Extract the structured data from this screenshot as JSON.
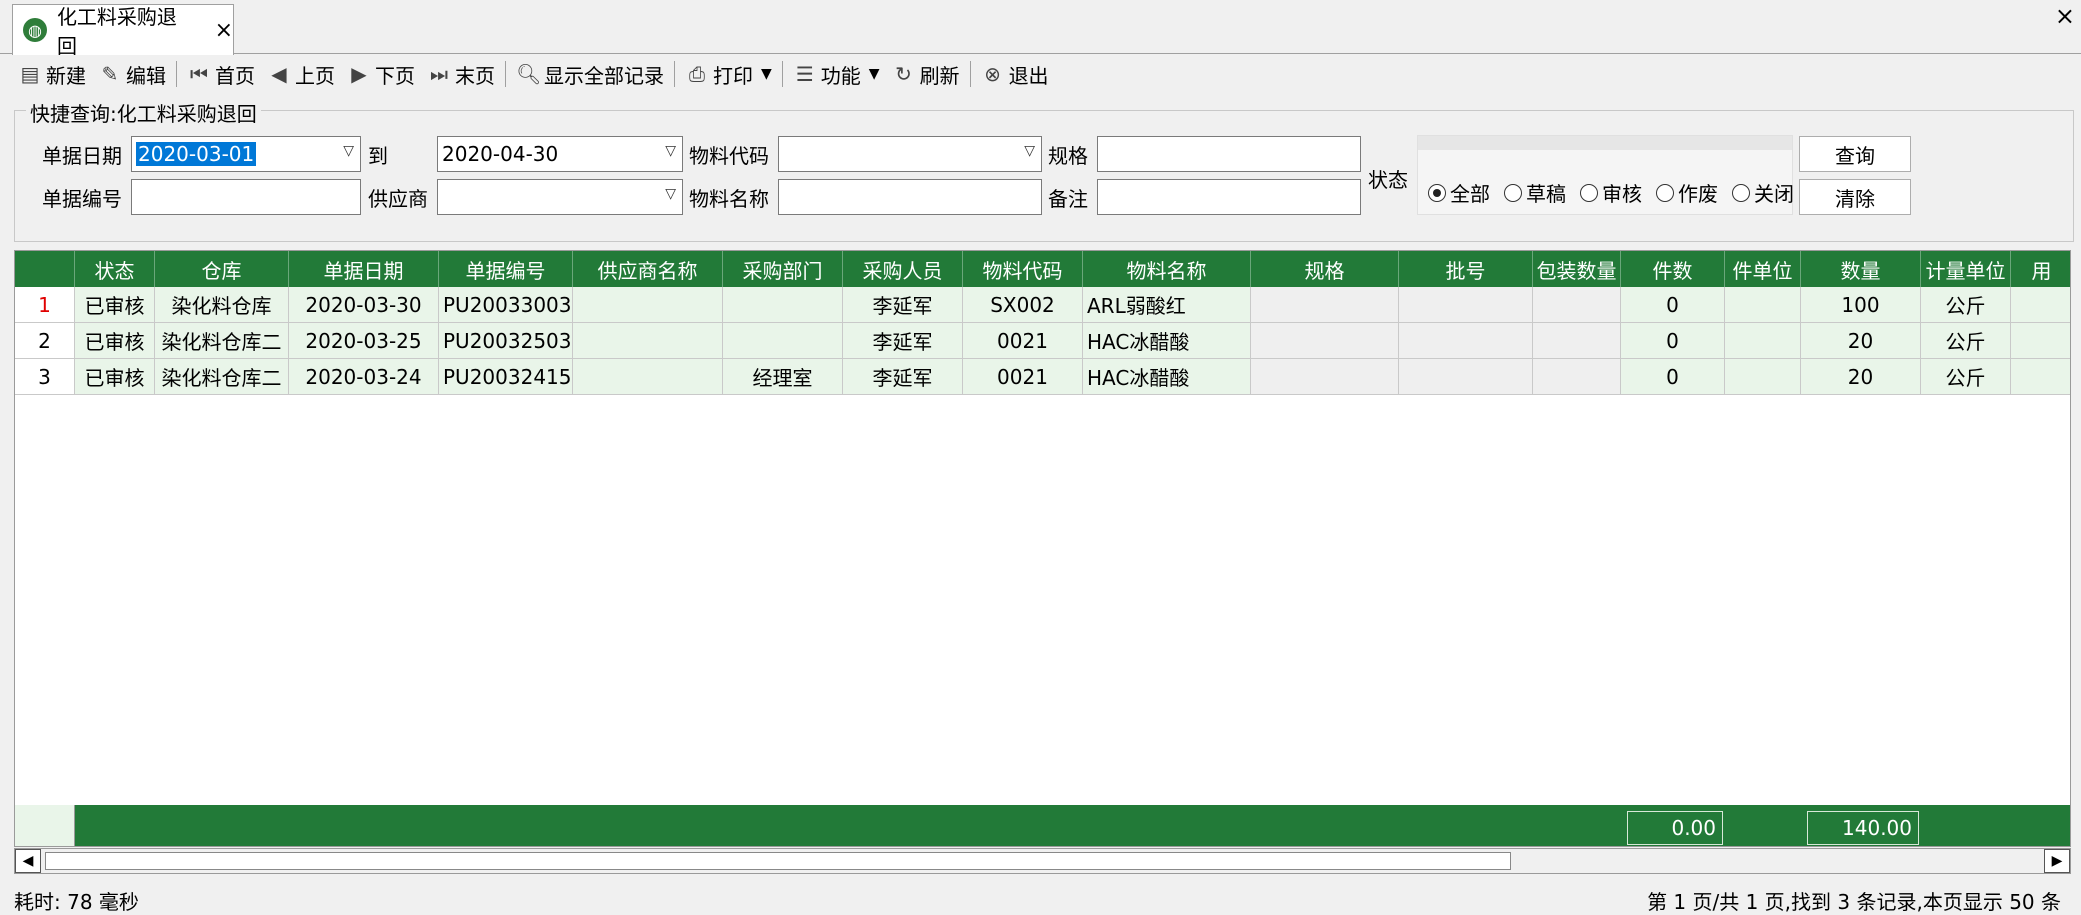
{
  "tab": {
    "title": "化工料采购退回",
    "close": "×"
  },
  "window": {
    "close": "×"
  },
  "toolbar": {
    "new": "新建",
    "edit": "编辑",
    "first": "首页",
    "prev": "上页",
    "next": "下页",
    "last": "末页",
    "show_all": "显示全部记录",
    "print": "打印",
    "function": "功能",
    "refresh": "刷新",
    "exit": "退出"
  },
  "query": {
    "group_title": "快捷查询:化工料采购退回",
    "doc_date_label": "单据日期",
    "doc_date_from": "2020-03-01",
    "to_label": "到",
    "doc_date_to": "2020-04-30",
    "material_code_label": "物料代码",
    "material_code": "",
    "spec_label": "规格",
    "spec": "",
    "status_label": "状态",
    "doc_no_label": "单据编号",
    "doc_no": "",
    "supplier_label": "供应商",
    "supplier": "",
    "material_name_label": "物料名称",
    "material_name": "",
    "remark_label": "备注",
    "remark": "",
    "status_options": [
      "全部",
      "草稿",
      "审核",
      "作废",
      "关闭"
    ],
    "status_selected": "全部",
    "search_button": "查询",
    "clear_button": "清除"
  },
  "grid": {
    "columns": [
      "",
      "状态",
      "仓库",
      "单据日期",
      "单据编号",
      "供应商名称",
      "采购部门",
      "采购人员",
      "物料代码",
      "物料名称",
      "规格",
      "批号",
      "包装数量",
      "件数",
      "件单位",
      "数量",
      "计量单位",
      "用"
    ],
    "rows": [
      [
        "1",
        "已审核",
        "染化料仓库",
        "2020-03-30",
        "PU20033003",
        "",
        "",
        "李延军",
        "SX002",
        "ARL弱酸红",
        "",
        "",
        "",
        "0",
        "",
        "100",
        "公斤",
        ""
      ],
      [
        "2",
        "已审核",
        "染化料仓库二",
        "2020-03-25",
        "PU20032503",
        "",
        "",
        "李延军",
        "0021",
        "HAC冰醋酸",
        "",
        "",
        "",
        "0",
        "",
        "20",
        "公斤",
        ""
      ],
      [
        "3",
        "已审核",
        "染化料仓库二",
        "2020-03-24",
        "PU20032415",
        "",
        "经理室",
        "李延军",
        "0021",
        "HAC冰醋酸",
        "",
        "",
        "",
        "0",
        "",
        "20",
        "公斤",
        ""
      ]
    ],
    "totals": {
      "pieces": "0.00",
      "quantity": "140.00"
    }
  },
  "scrollbar": {
    "left": "◀",
    "right": "▶"
  },
  "status": {
    "elapsed": "耗时: 78 毫秒",
    "paging": "第 1 页/共 1 页,找到 3 条记录,本页显示 50 条"
  }
}
